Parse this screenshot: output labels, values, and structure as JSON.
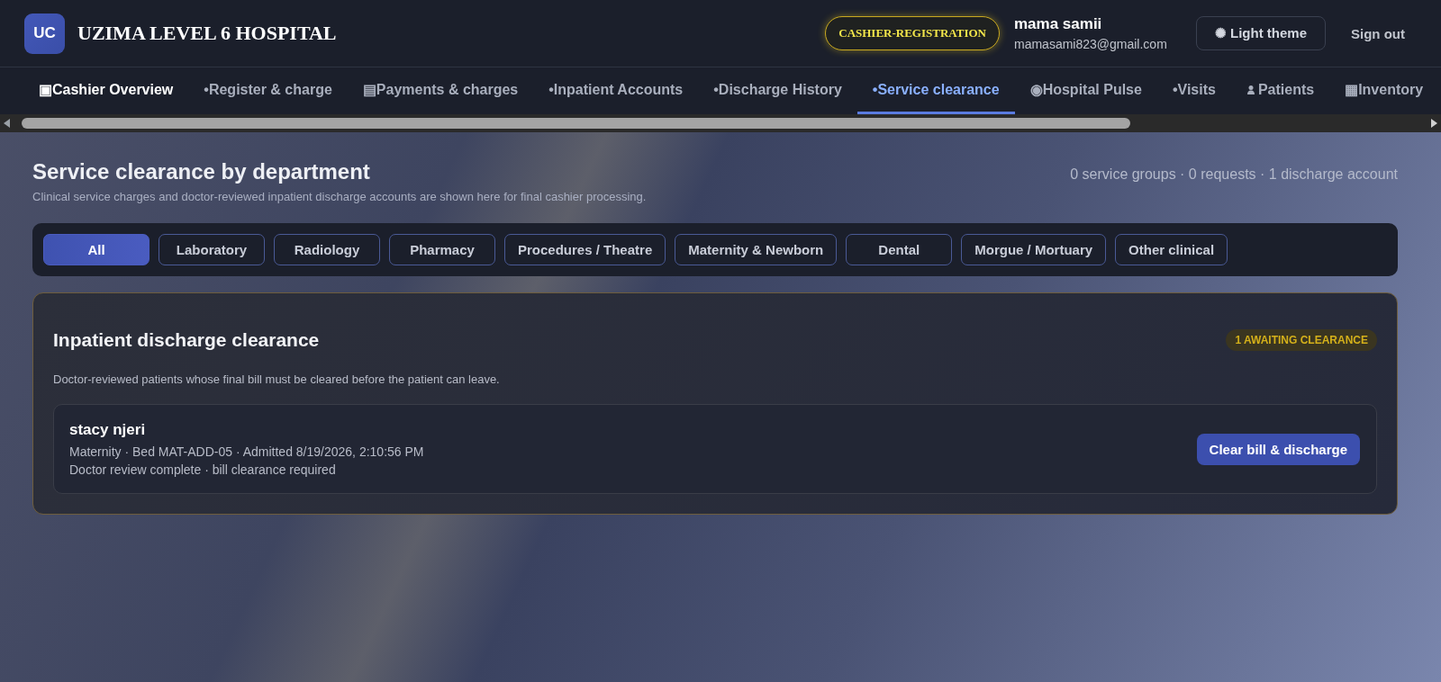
{
  "header": {
    "logo": "UC",
    "title": "UZIMA LEVEL 6 HOSPITAL",
    "role_badge": "CASHIER-REGISTRATION",
    "user": {
      "name": "mama samii",
      "email": "mamasami823@gmail.com"
    },
    "theme_button": "✺ Light theme",
    "sign_out": "Sign out"
  },
  "nav": [
    {
      "label": "▣Cashier Overview",
      "kind": "text",
      "selected": false
    },
    {
      "label": "•Register & charge",
      "kind": "text",
      "selected": false
    },
    {
      "label": "▤Payments & charges",
      "kind": "text",
      "selected": false
    },
    {
      "label": "•Inpatient Accounts",
      "kind": "text",
      "selected": false
    },
    {
      "label": "•Discharge History",
      "kind": "text",
      "selected": false
    },
    {
      "label": "•Service clearance",
      "kind": "text",
      "selected": true
    },
    {
      "label": "◉Hospital Pulse",
      "kind": "text",
      "selected": false
    },
    {
      "label": "•Visits",
      "kind": "text",
      "selected": false
    },
    {
      "label": "Patients",
      "kind": "person",
      "selected": false
    },
    {
      "label": "▦Inventory",
      "kind": "text",
      "selected": false
    }
  ],
  "page": {
    "title": "Service clearance by department",
    "subtitle": "Clinical service charges and doctor-reviewed inpatient discharge accounts are shown here for final cashier processing.",
    "summary": "0 service groups · 0 requests · 1 discharge account"
  },
  "filters": [
    {
      "label": "All",
      "selected": true
    },
    {
      "label": "Laboratory",
      "selected": false
    },
    {
      "label": "Radiology",
      "selected": false
    },
    {
      "label": "Pharmacy",
      "selected": false
    },
    {
      "label": "Procedures / Theatre",
      "selected": false
    },
    {
      "label": "Maternity & Newborn",
      "selected": false
    },
    {
      "label": "Dental",
      "selected": false
    },
    {
      "label": "Morgue / Mortuary",
      "selected": false
    },
    {
      "label": "Other clinical",
      "selected": false
    }
  ],
  "discharge": {
    "title": "Inpatient discharge clearance",
    "badge": "1 AWAITING CLEARANCE",
    "description": "Doctor-reviewed patients whose final bill must be cleared before the patient can leave.",
    "patients": [
      {
        "name": "stacy njeri",
        "details": "Maternity · Bed MAT-ADD-05 · Admitted 8/19/2026, 2:10:56 PM",
        "status": "Doctor review complete · bill clearance required",
        "action": "Clear bill & discharge"
      }
    ]
  }
}
